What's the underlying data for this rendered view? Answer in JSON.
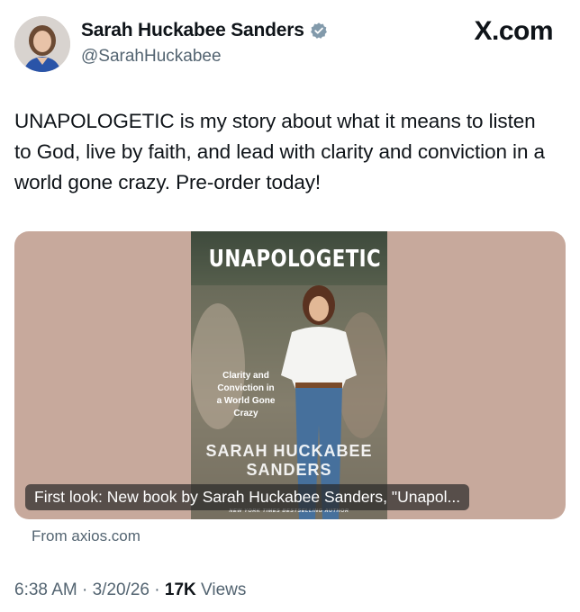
{
  "author": {
    "display_name": "Sarah Huckabee Sanders",
    "handle": "@SarahHuckabee",
    "verified_icon": "verified-badge-icon"
  },
  "brand": "X.com",
  "tweet": {
    "text": "UNAPOLOGETIC is my story about what it means to listen to God, live by faith, and lead with clarity and conviction in a world gone crazy. Pre-order today!"
  },
  "link_card": {
    "image": {
      "title": "UNAPOLOGETIC",
      "subtitle": "Clarity and Conviction in a World Gone Crazy",
      "author_on_cover": "SARAH HUCKABEE SANDERS",
      "banner": "NEW YORK TIMES BESTSELLING AUTHOR"
    },
    "caption": "First look: New book by Sarah Huckabee Sanders, \"Unapol...",
    "source": "From axios.com"
  },
  "meta": {
    "time": "6:38 AM",
    "date": "3/20/26",
    "views_count": "17K",
    "views_label": "Views"
  },
  "colors": {
    "card_background": "#c7a99c",
    "verified": "#829aab",
    "secondary_text": "#536471"
  }
}
